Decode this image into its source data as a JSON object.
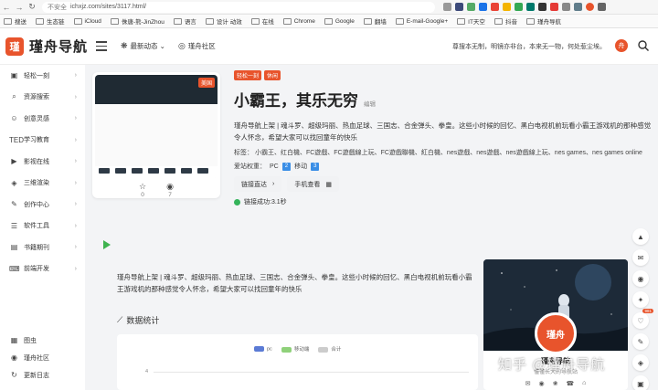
{
  "browser": {
    "back": "←",
    "forward": "→",
    "reload": "↻",
    "security_text": "不安全",
    "url": "ichxjz.com/sites/3117.html/"
  },
  "bookmarks": [
    "搜送",
    "生态链",
    "iCloud",
    "侏唐-熊-JinZhou",
    "语言",
    "设计 动效",
    "在线",
    "Chrome",
    "Google",
    "翻墙",
    "E-mail-Google+",
    "IT天空",
    "抖音",
    "瑾舟导航"
  ],
  "header": {
    "logo_mark": "瑾",
    "logo_text": "瑾舟导航",
    "nav": [
      {
        "icon": "❋",
        "label": "最新动态",
        "chevron": "⌄"
      },
      {
        "icon": "◎",
        "label": "瑾舟社区",
        "chevron": ""
      }
    ],
    "slogan": "尊搜本无制，明镜亦非台，本来无一物，何处惹尘埃。",
    "avatar_letter": "舟",
    "search_icon": "search-icon"
  },
  "sidebar": {
    "items": [
      {
        "icon": "▣",
        "label": "轻松一刻"
      },
      {
        "icon": "⌕",
        "label": "资源搜索"
      },
      {
        "icon": "☺",
        "label": "创意灵感"
      },
      {
        "icon": "TED",
        "label": "学习教育"
      },
      {
        "icon": "▶",
        "label": "影视在线"
      },
      {
        "icon": "◈",
        "label": "三维渲染"
      },
      {
        "icon": "✎",
        "label": "创作中心"
      },
      {
        "icon": "☰",
        "label": "软件工具"
      },
      {
        "icon": "▤",
        "label": "书籍期刊"
      },
      {
        "icon": "⌨",
        "label": "前端开发"
      }
    ],
    "chevron": "›",
    "bottom": [
      {
        "icon": "▦",
        "label": "图虫"
      },
      {
        "icon": "◉",
        "label": "瑾舟社区"
      },
      {
        "icon": "↻",
        "label": "更新日志"
      }
    ]
  },
  "site": {
    "thumb_badge": "美国",
    "stats": [
      {
        "icon": "☆",
        "value": "0"
      },
      {
        "icon": "◉",
        "value": "7"
      }
    ],
    "tags_top": [
      "轻松一刻",
      "休闲"
    ],
    "title": "小霸王，其乐无穷",
    "edit_label": "编辑",
    "description": "瑾舟导航上架 | 魂斗罗、超级玛丽、热血足球、三国志、合金弹头、拳皇。这些小时候的回忆、黑白电视机前玩看小霸王游戏机的那种感觉令人怀念，希望大家可以找回童年的快乐",
    "tag_line": "标签： 小霸王、红白機、FC遊戲、FC遊戲線上玩、FC遊戲聯機、紅白機、nes遊戲、nes遊戲、nes遊戲線上玩、nes games、nes games online",
    "weights_label": "爱站权重：",
    "weights": [
      {
        "label": "PC",
        "value": "2"
      },
      {
        "label": "移动",
        "value": "3"
      }
    ],
    "buttons": [
      {
        "label": "链接直达",
        "icon": "›"
      },
      {
        "label": "手机查看",
        "icon": "▦"
      }
    ],
    "link_status": "链接成功:3.1秒"
  },
  "summary": "瑾舟导航上架 | 魂斗罗、超级玛丽、热血足球、三国志、合金弹头、拳皇。这些小时候的回忆、黑白电视机前玩看小霸王游戏机的那种感觉令人怀念，希望大家可以找回童年的快乐",
  "stats_section": {
    "icon": "⟋",
    "title": "数据统计",
    "legend": [
      {
        "label": "pc",
        "color": "#5b7bd5"
      },
      {
        "label": "移动端",
        "color": "#8fd17a"
      },
      {
        "label": "合计",
        "color": "#cccccc"
      }
    ],
    "y_tick": "4"
  },
  "chart_data": {
    "type": "bar",
    "series": [
      {
        "name": "pc",
        "values": []
      },
      {
        "name": "移动端",
        "values": []
      },
      {
        "name": "合计",
        "values": []
      }
    ],
    "y_ticks": [
      "4"
    ]
  },
  "author": {
    "avatar_text": "瑾舟",
    "name": "瑾舟导航",
    "subtitle": "懂懂长大的导航站",
    "links": [
      "✉",
      "◉",
      "❀",
      "☎",
      "⌂"
    ]
  },
  "watermark": "知乎 @瑾舟导航",
  "float_tools": [
    {
      "icon": "▲",
      "badge": ""
    },
    {
      "icon": "✉",
      "badge": ""
    },
    {
      "icon": "◉",
      "badge": ""
    },
    {
      "icon": "✦",
      "badge": ""
    },
    {
      "icon": "♡",
      "badge": "981"
    },
    {
      "icon": "✎",
      "badge": ""
    },
    {
      "icon": "◈",
      "badge": ""
    },
    {
      "icon": "▣",
      "badge": ""
    }
  ]
}
